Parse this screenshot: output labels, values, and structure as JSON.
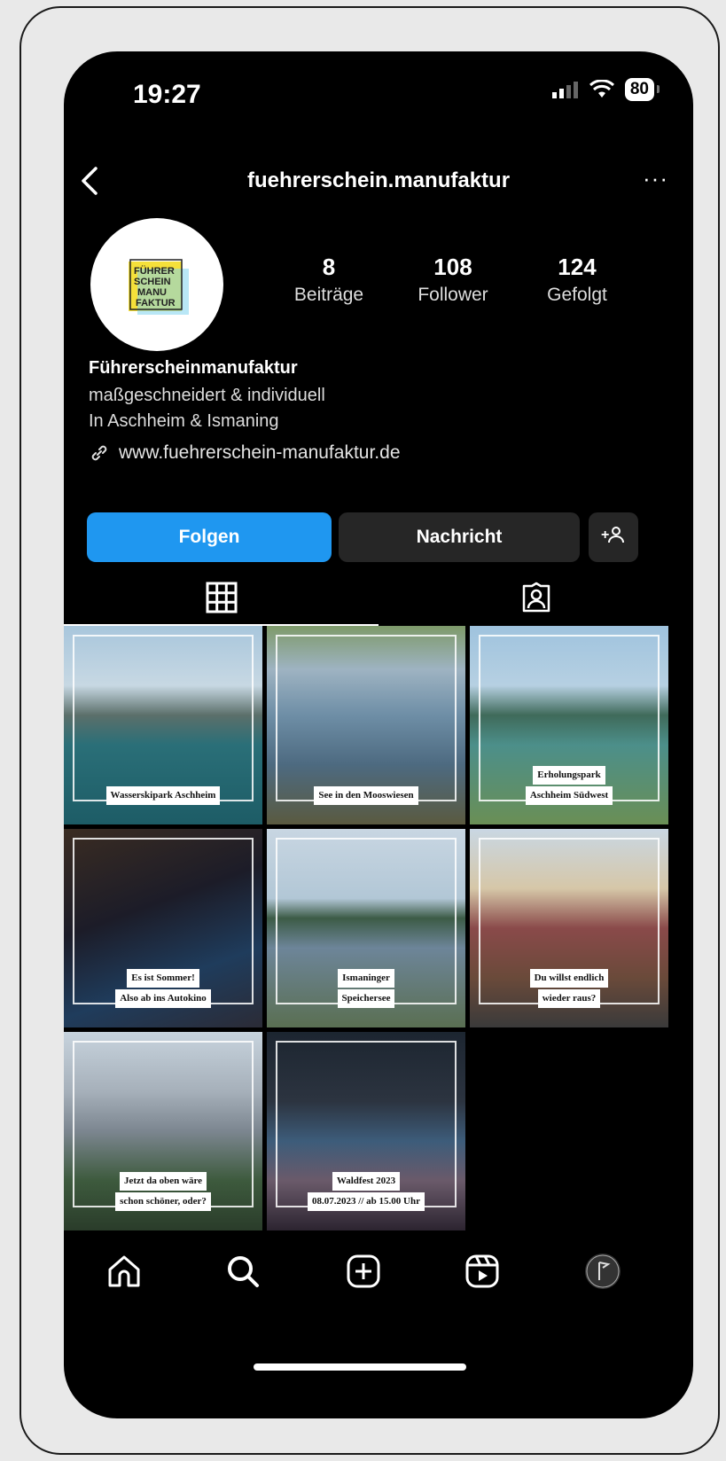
{
  "status_bar": {
    "time": "19:27",
    "battery": "80"
  },
  "header": {
    "username": "fuehrerschein.manufaktur",
    "more": "···"
  },
  "avatar": {
    "logo_lines": [
      "FÜHRER",
      "SCHEIN",
      "MANU",
      "FAKTUR"
    ]
  },
  "stats": [
    {
      "value": "8",
      "label": "Beiträge"
    },
    {
      "value": "108",
      "label": "Follower"
    },
    {
      "value": "124",
      "label": "Gefolgt"
    }
  ],
  "bio": {
    "name": "Führerscheinmanufaktur",
    "line1": "maßgeschneidert & individuell",
    "line2": "In Aschheim & Ismaning",
    "link": "www.fuehrerschein-manufaktur.de"
  },
  "actions": {
    "follow": "Folgen",
    "message": "Nachricht",
    "suggest": "+"
  },
  "posts": [
    {
      "caption": [
        "Wasserskipark Aschheim"
      ],
      "bg": "linear-gradient(180deg,#a8c6dc 0%,#c7d8e3 30%,#5b6f6a 45%,#2a6f78 60%,#1d5c66 100%)"
    },
    {
      "caption": [
        "See in den Mooswiesen"
      ],
      "bg": "linear-gradient(180deg,#7e9a6a 0%,#9eb3c2 22%,#6e8ea6 45%,#4d6a80 70%,#5a5a40 100%)"
    },
    {
      "caption": [
        "Erholungspark",
        "Aschheim Südwest"
      ],
      "bg": "linear-gradient(180deg,#9fc3de 0%,#b6d0e2 30%,#3f6a5a 45%,#4c8f8a 60%,#6a8f55 100%)"
    },
    {
      "caption": [
        "Es ist Sommer!",
        "Also ab ins Autokino"
      ],
      "bg": "linear-gradient(160deg,#3a2c22 0%,#1c1c28 40%,#1f3c5c 70%,#2b2b36 100%)"
    },
    {
      "caption": [
        "Ismaninger",
        "Speichersee"
      ],
      "bg": "linear-gradient(180deg,#c8d6e2 0%,#b2c7d6 35%,#3c5b46 45%,#6d8599 60%,#5a6f52 100%)"
    },
    {
      "caption": [
        "Du willst endlich",
        "wieder raus?"
      ],
      "bg": "linear-gradient(180deg,#c9d7e3 0%,#d6c7a8 30%,#8a4a4a 50%,#6a4a3a 75%,#3a3a3a 100%)"
    },
    {
      "caption": [
        "Jetzt da oben wäre",
        "schon schöner, oder?"
      ],
      "bg": "linear-gradient(180deg,#c7d3dd 0%,#a6b0ba 30%,#7c8690 50%,#3d5a3d 75%,#2a3c2a 100%)"
    },
    {
      "caption": [
        "Waldfest 2023",
        "08.07.2023 // ab 15.00 Uhr"
      ],
      "bg": "linear-gradient(180deg,#1c2530 0%,#2c3440 35%,#3d5c7a 55%,#6a5a6a 75%,#2c2430 100%)"
    }
  ],
  "bottom_nav": [
    "home-icon",
    "search-icon",
    "create-icon",
    "reels-icon",
    "profile-icon"
  ]
}
